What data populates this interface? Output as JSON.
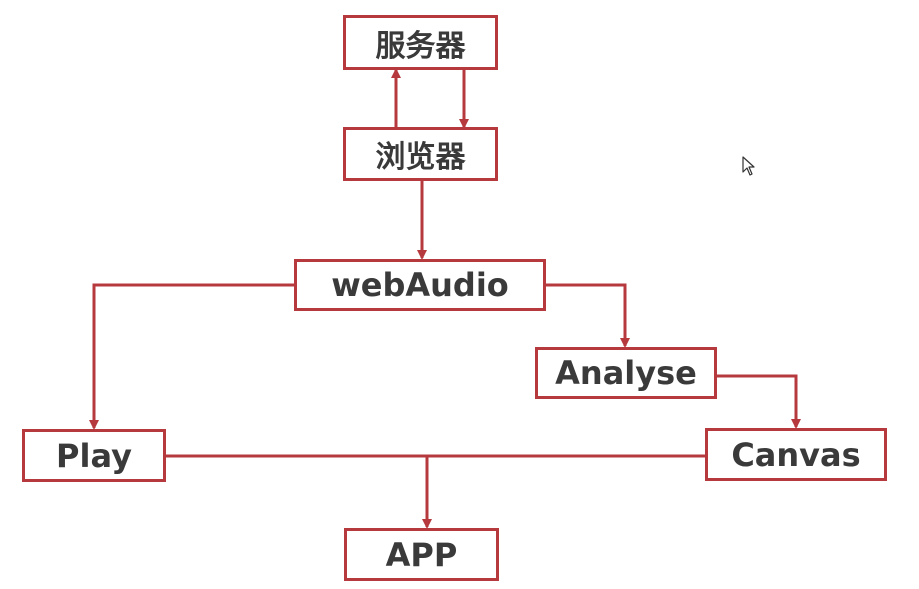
{
  "colors": {
    "accent": "#b5393d",
    "text": "#3a3a3a",
    "background": "#ffffff"
  },
  "nodes": {
    "server": "服务器",
    "browser": "浏览器",
    "webaudio": "webAudio",
    "analyse": "Analyse",
    "play": "Play",
    "canvas": "Canvas",
    "app": "APP"
  },
  "edges": [
    [
      "browser",
      "server"
    ],
    [
      "server",
      "browser"
    ],
    [
      "browser",
      "webaudio"
    ],
    [
      "webaudio",
      "play"
    ],
    [
      "webaudio",
      "analyse"
    ],
    [
      "analyse",
      "canvas"
    ],
    [
      "play",
      "app"
    ],
    [
      "canvas",
      "app"
    ]
  ],
  "cursor_icon": "mouse-pointer-icon"
}
